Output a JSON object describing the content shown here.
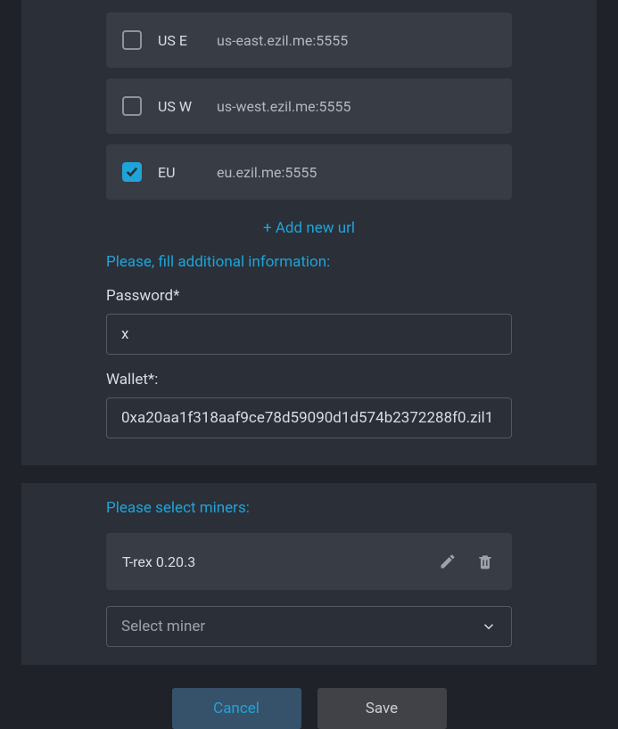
{
  "urls": [
    {
      "region": "US E",
      "url": "us-east.ezil.me:5555",
      "checked": false
    },
    {
      "region": "US W",
      "url": "us-west.ezil.me:5555",
      "checked": false
    },
    {
      "region": "EU",
      "url": "eu.ezil.me:5555",
      "checked": true
    }
  ],
  "add_url_label": "+ Add new url",
  "additional_info_label": "Please, fill additional information:",
  "password": {
    "label": "Password*",
    "value": "x"
  },
  "wallet": {
    "label": "Wallet*:",
    "value": "0xa20aa1f318aaf9ce78d59090d1d574b2372288f0.zil1"
  },
  "miners_label": "Please select miners:",
  "miner": {
    "name": "T-rex 0.20.3"
  },
  "select_placeholder": "Select miner",
  "buttons": {
    "cancel": "Cancel",
    "save": "Save"
  }
}
